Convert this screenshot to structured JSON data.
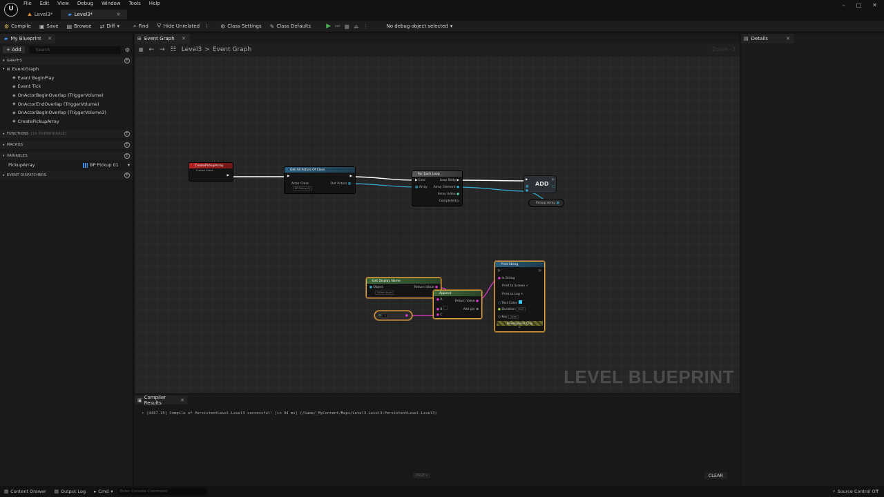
{
  "menu": [
    "File",
    "Edit",
    "View",
    "Debug",
    "Window",
    "Tools",
    "Help"
  ],
  "logo_text": "U",
  "tabs": [
    {
      "label": "Level3*",
      "active": false
    },
    {
      "label": "Level3*",
      "active": true
    }
  ],
  "window_controls": [
    "–",
    "□",
    "✕"
  ],
  "toolbar": {
    "compile": "Compile",
    "save": "Save",
    "browse": "Browse",
    "diff": "Diff",
    "find": "Find",
    "hide_unrelated": "Hide Unrelated",
    "class_settings": "Class Settings",
    "class_defaults": "Class Defaults",
    "debug_dropdown": "No debug object selected"
  },
  "my_blueprint": {
    "tab": "My Blueprint",
    "add": "+ Add",
    "search_placeholder": "Search",
    "graphs_header": "GRAPHS",
    "graph_root": "EventGraph",
    "graph_items": [
      "Event BeginPlay",
      "Event Tick",
      "OnActorBeginOverlap (TriggerVolume)",
      "OnActorEndOverlap (TriggerVolume)",
      "OnActorBeginOverlap (TriggerVolume3)",
      "CreatePickupArray"
    ],
    "functions_header": "FUNCTIONS",
    "functions_note": "(19 OVERRIDABLE)",
    "macros_header": "MACROS",
    "variables_header": "VARIABLES",
    "variable_name": "PickupArray",
    "variable_type": "BP Pickup 01",
    "dispatchers_header": "EVENT DISPATCHERS"
  },
  "graph": {
    "tab": "Event Graph",
    "breadcrumb_root": "Level3",
    "breadcrumb_sep": ">",
    "breadcrumb_leaf": "Event Graph",
    "zoom": "Zoom -2",
    "watermark": "LEVEL BLUEPRINT"
  },
  "nodes": {
    "custom_event_title": "CreatePickupArray",
    "custom_event_sub": "Custom Event",
    "get_actors_title": "Get All Actors Of Class",
    "actor_class_label": "Actor Class",
    "actor_class_value": "BP Pickup 01",
    "out_actors_label": "Out Actors",
    "foreach_title": "For Each Loop",
    "foreach_pins": [
      "Exec",
      "Array",
      "Loop Body",
      "Array Element",
      "Array Index",
      "Completed"
    ],
    "add_label": "ADD",
    "pickup_array_label": "Pickup Array",
    "display_name_title": "Get Display Name",
    "object_label": "Object",
    "select_asset": "Select Asset",
    "return_value_label": "Return Value",
    "append_title": "Append",
    "append_pins": [
      "A",
      "B",
      "C",
      "Return Value",
      "Add pin"
    ],
    "literal_value": "1",
    "print_title": "Print String",
    "print_pins": [
      "In String",
      "Print to Screen",
      "Print to Log",
      "Text Color",
      "Duration",
      "Key"
    ],
    "duration_value": "60.0",
    "key_value": "None",
    "dev_only": "Development Only"
  },
  "compiler": {
    "tab": "Compiler Results",
    "message": "[4467.15] Compile of PersistentLevel.Level3 successful! [in 94 ms] (/Game/_MyContent/Maps/Level3.Level3:PersistentLevel.Level3)",
    "page": "PAGE",
    "clear": "CLEAR"
  },
  "details": {
    "tab": "Details"
  },
  "statusbar": {
    "content_drawer": "Content Drawer",
    "output_log": "Output Log",
    "cmd": "Cmd",
    "console_placeholder": "Enter Console Command",
    "source_control": "Source Control Off"
  },
  "colors": {
    "event_red": "#9e1f1f",
    "function_blue": "#2c5e7e",
    "flow_gray": "#5a5a5a",
    "pure_green": "#3f6a3a",
    "string_magenta": "#e93bd9",
    "object_cyan": "#35b0d8",
    "selection": "#e8a33b"
  }
}
